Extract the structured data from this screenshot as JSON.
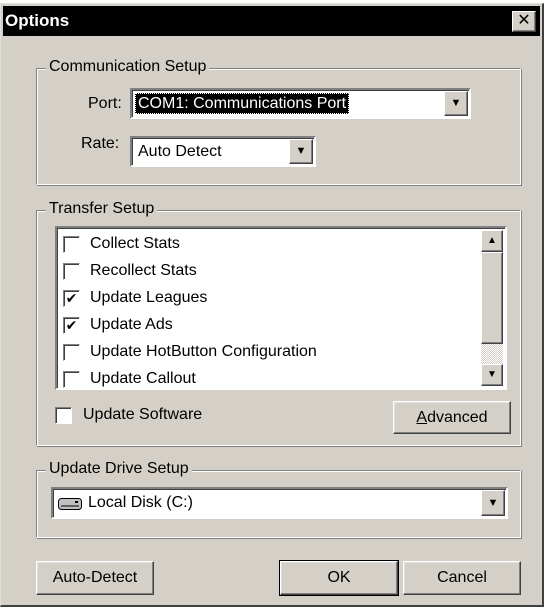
{
  "window": {
    "title": "Options",
    "close_glyph": "✕"
  },
  "communication": {
    "label": "Communication Setup",
    "port_label": "Port:",
    "port_value": "COM1: Communications Port",
    "rate_label": "Rate:",
    "rate_value": "Auto Detect"
  },
  "transfer": {
    "label": "Transfer Setup",
    "items": [
      {
        "label": "Collect Stats",
        "checked": false
      },
      {
        "label": "Recollect Stats",
        "checked": false
      },
      {
        "label": "Update Leagues",
        "checked": true
      },
      {
        "label": "Update Ads",
        "checked": true
      },
      {
        "label": "Update HotButton Configuration",
        "checked": false
      },
      {
        "label": "Update Callout",
        "checked": false
      }
    ],
    "update_software_label": "Update Software",
    "update_software_checked": false,
    "advanced_first": "A",
    "advanced_rest": "dvanced"
  },
  "drive": {
    "label": "Update Drive Setup",
    "value": "Local Disk (C:)",
    "icon": "hard-disk-icon"
  },
  "buttons": {
    "auto_detect": "Auto-Detect",
    "ok": "OK",
    "cancel": "Cancel"
  },
  "icons": {
    "dropdown": "▼",
    "scroll_up": "▲",
    "scroll_down": "▼",
    "check": "✔"
  }
}
